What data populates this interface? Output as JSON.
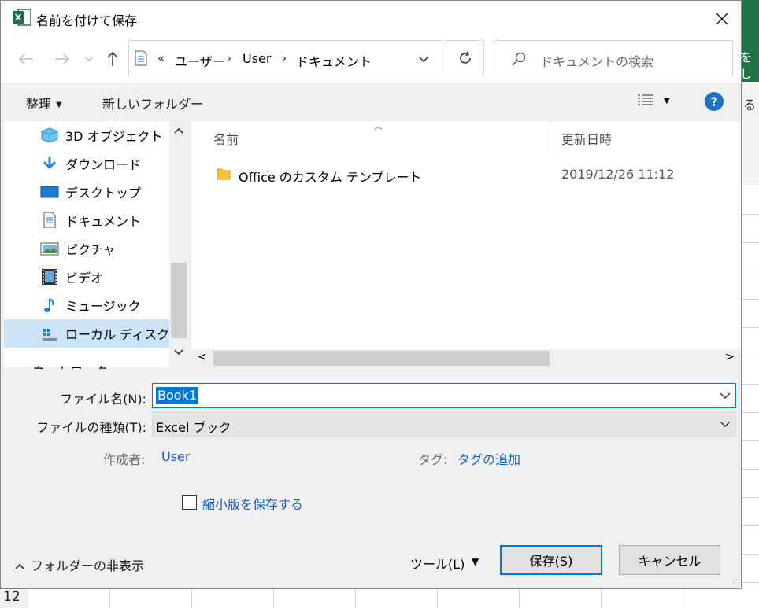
{
  "background": {
    "right_text": "をし",
    "right_text2": "る",
    "row_number": "12"
  },
  "window": {
    "title": "名前を付けて保存",
    "app_icon_letter": "X"
  },
  "nav": {
    "address_overflow": "«",
    "breadcrumb": [
      "ユーザー",
      "User",
      "ドキュメント"
    ],
    "search_placeholder": "ドキュメントの検索"
  },
  "toolbar": {
    "organize_label": "整理",
    "new_folder_label": "新しいフォルダー"
  },
  "sidebar": {
    "items": [
      {
        "label": "3D オブジェクト",
        "icon": "cube-icon"
      },
      {
        "label": "ダウンロード",
        "icon": "download-arrow-icon"
      },
      {
        "label": "デスクトップ",
        "icon": "desktop-icon"
      },
      {
        "label": "ドキュメント",
        "icon": "document-icon"
      },
      {
        "label": "ピクチャ",
        "icon": "pictures-icon"
      },
      {
        "label": "ビデオ",
        "icon": "video-icon"
      },
      {
        "label": "ミュージック",
        "icon": "music-icon"
      },
      {
        "label": "ローカル ディスク (C",
        "icon": "disk-icon",
        "selected": true
      }
    ],
    "partial_item": "ネットワーク"
  },
  "files": {
    "columns": [
      "名前",
      "更新日時"
    ],
    "rows": [
      {
        "name": "Office のカスタム テンプレート",
        "modified": "2019/12/26 11:12",
        "icon": "folder-icon"
      }
    ]
  },
  "form": {
    "filename_label": "ファイル名(N):",
    "filename_value": "Book1",
    "filetype_label": "ファイルの種類(T):",
    "filetype_value": "Excel ブック",
    "author_label": "作成者:",
    "author_value": "User",
    "tags_label": "タグ:",
    "tags_value": "タグの追加",
    "thumbnail_label": "縮小版を保存する"
  },
  "footer": {
    "hide_folders_label": "フォルダーの非表示",
    "tools_label": "ツール(L)",
    "save_label": "保存(S)",
    "cancel_label": "キャンセル"
  },
  "colors": {
    "excel_green": "#217346",
    "accent_blue": "#0078d7",
    "link_blue": "#1a5fb4",
    "selection_bg": "#cce4f7"
  }
}
